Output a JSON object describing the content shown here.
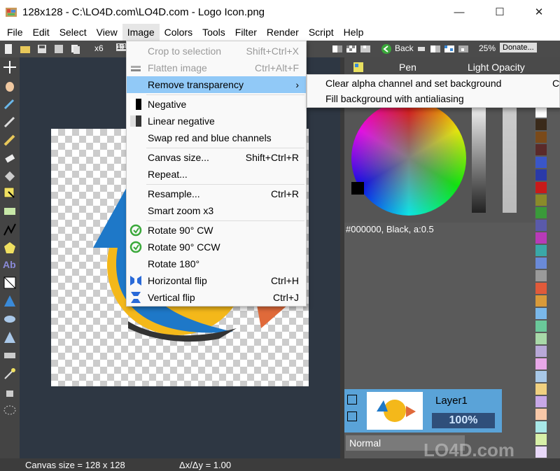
{
  "window": {
    "title": "128x128 - C:\\LO4D.com\\LO4D.com - Logo Icon.png",
    "controls": [
      "—",
      "☐",
      "✕"
    ]
  },
  "menubar": [
    "File",
    "Edit",
    "Select",
    "View",
    "Image",
    "Colors",
    "Tools",
    "Filter",
    "Render",
    "Script",
    "Help"
  ],
  "toolbar": {
    "zoom_factor": "x6",
    "back_label": "Back",
    "zoom_percent": "25%",
    "donate_label": "Donate..."
  },
  "image_menu": {
    "items": [
      {
        "label": "Crop to selection",
        "shortcut": "Shift+Ctrl+X",
        "disabled": true
      },
      {
        "label": "Flatten image",
        "shortcut": "Ctrl+Alt+F",
        "disabled": true
      },
      {
        "label": "Remove transparency",
        "shortcut": "›",
        "highlighted": true
      },
      {
        "label": "Negative",
        "shortcut": ""
      },
      {
        "label": "Linear negative",
        "shortcut": ""
      },
      {
        "label": "Swap red and blue channels",
        "shortcut": ""
      },
      {
        "label": "Canvas size...",
        "shortcut": "Shift+Ctrl+R"
      },
      {
        "label": "Repeat...",
        "shortcut": ""
      },
      {
        "label": "Resample...",
        "shortcut": "Ctrl+R"
      },
      {
        "label": "Smart zoom x3",
        "shortcut": ""
      },
      {
        "label": "Rotate 90° CW",
        "shortcut": ""
      },
      {
        "label": "Rotate 90° CCW",
        "shortcut": ""
      },
      {
        "label": "Rotate 180°",
        "shortcut": ""
      },
      {
        "label": "Horizontal flip",
        "shortcut": "Ctrl+H"
      },
      {
        "label": "Vertical flip",
        "shortcut": "Ctrl+J"
      }
    ],
    "submenu": [
      {
        "label": "Clear alpha channel and set background",
        "shortcut": "Ct"
      },
      {
        "label": "Fill background with antialiasing",
        "shortcut": ""
      }
    ]
  },
  "right_panel": {
    "pen_label": "Pen",
    "opacity_label": "Light Opacity",
    "color_info": "#000000, Black, a:0.5",
    "layer_name": "Layer1",
    "layer_opacity": "100%",
    "blend_mode": "Normal"
  },
  "statusbar": {
    "canvas_size": "Canvas size = 128 x 128",
    "ratio": "Δx/Δy = 1.00"
  },
  "watermark": "LO4D.com",
  "colors": {
    "palette": [
      "#ffffff",
      "#3a2a1a",
      "#7a4a1a",
      "#5a2a2a",
      "#3a56c8",
      "#2a3aa8",
      "#c81a1a",
      "#8a8a2a",
      "#3a9a3a",
      "#5a5aaa",
      "#b83ab8",
      "#3aa8a8",
      "#6a8ad8",
      "#9a9a9a",
      "#e05a3a",
      "#d89a3a",
      "#7ab8ea",
      "#6ac89a",
      "#a8d8a8",
      "#b8a8d8",
      "#e8a8e8",
      "#a8c8e8",
      "#f0d080",
      "#c8a8e8",
      "#f8c8a8",
      "#a8e8e8",
      "#d8f0a8",
      "#e8d8f8",
      "#f8f8c8"
    ]
  }
}
